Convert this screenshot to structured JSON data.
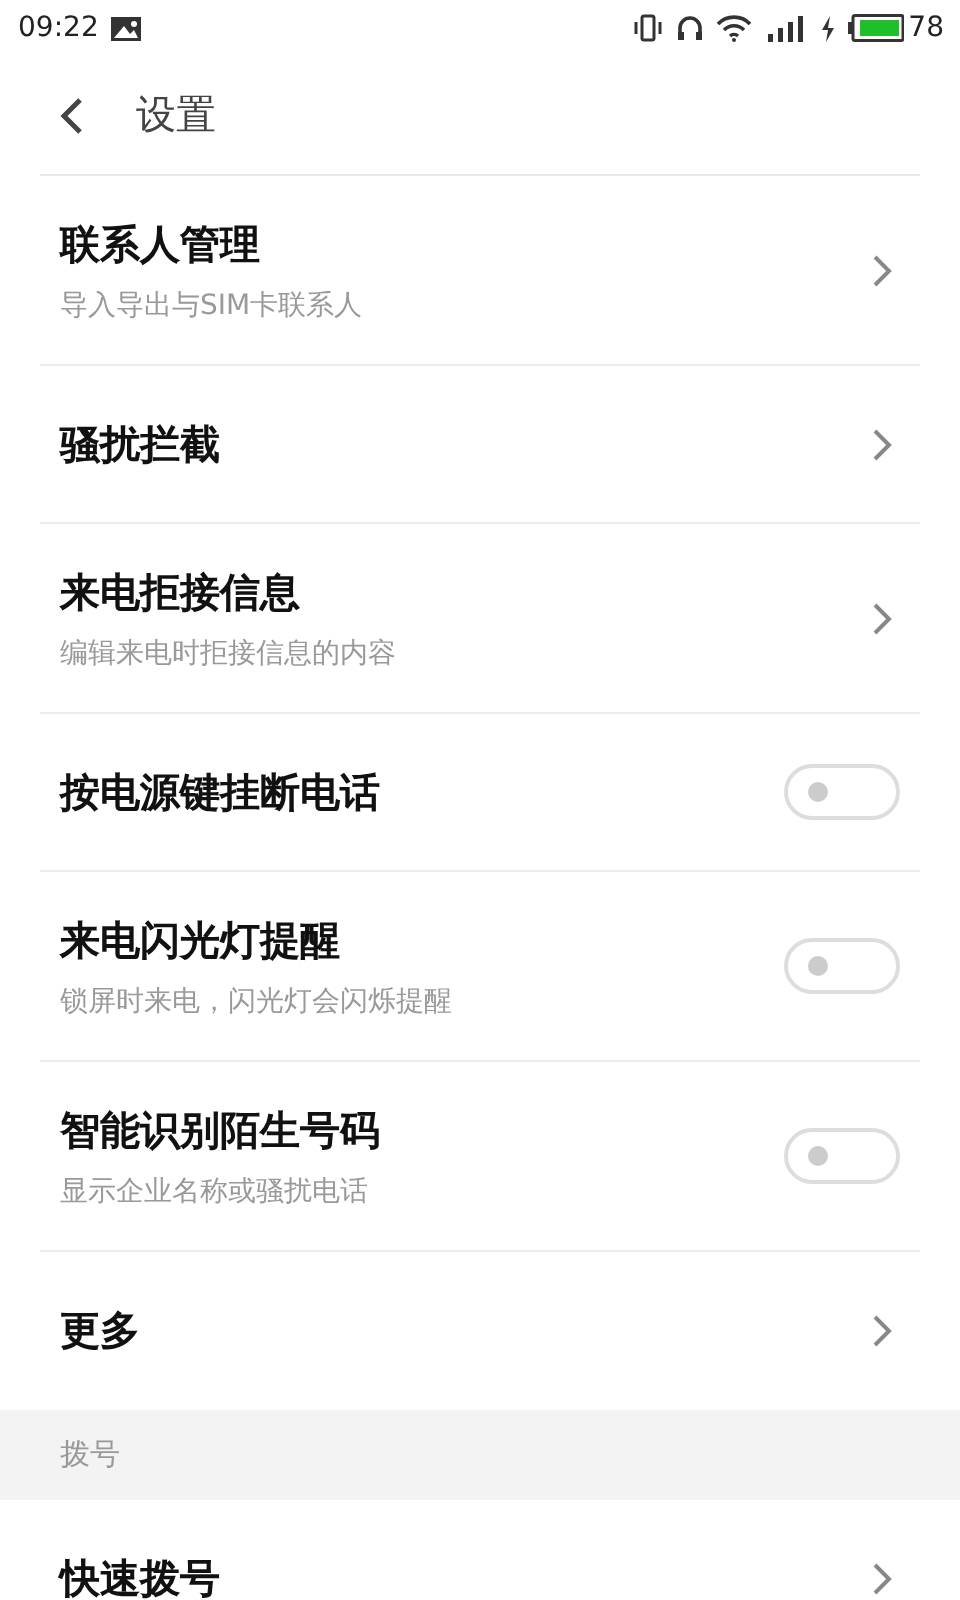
{
  "status_bar": {
    "time": "09:22",
    "battery": "78"
  },
  "header": {
    "title": "设置"
  },
  "sections": [
    {
      "items": [
        {
          "kind": "link",
          "title": "联系人管理",
          "subtitle": "导入导出与SIM卡联系人"
        },
        {
          "kind": "link",
          "title": "骚扰拦截"
        },
        {
          "kind": "link",
          "title": "来电拒接信息",
          "subtitle": "编辑来电时拒接信息的内容"
        },
        {
          "kind": "toggle",
          "title": "按电源键挂断电话",
          "on": false
        },
        {
          "kind": "toggle",
          "title": "来电闪光灯提醒",
          "subtitle": "锁屏时来电，闪光灯会闪烁提醒",
          "on": false
        },
        {
          "kind": "toggle",
          "title": "智能识别陌生号码",
          "subtitle": "显示企业名称或骚扰电话",
          "on": false
        },
        {
          "kind": "link",
          "title": "更多"
        }
      ]
    },
    {
      "header": "拨号",
      "items": [
        {
          "kind": "link",
          "title": "快速拨号"
        }
      ]
    }
  ]
}
